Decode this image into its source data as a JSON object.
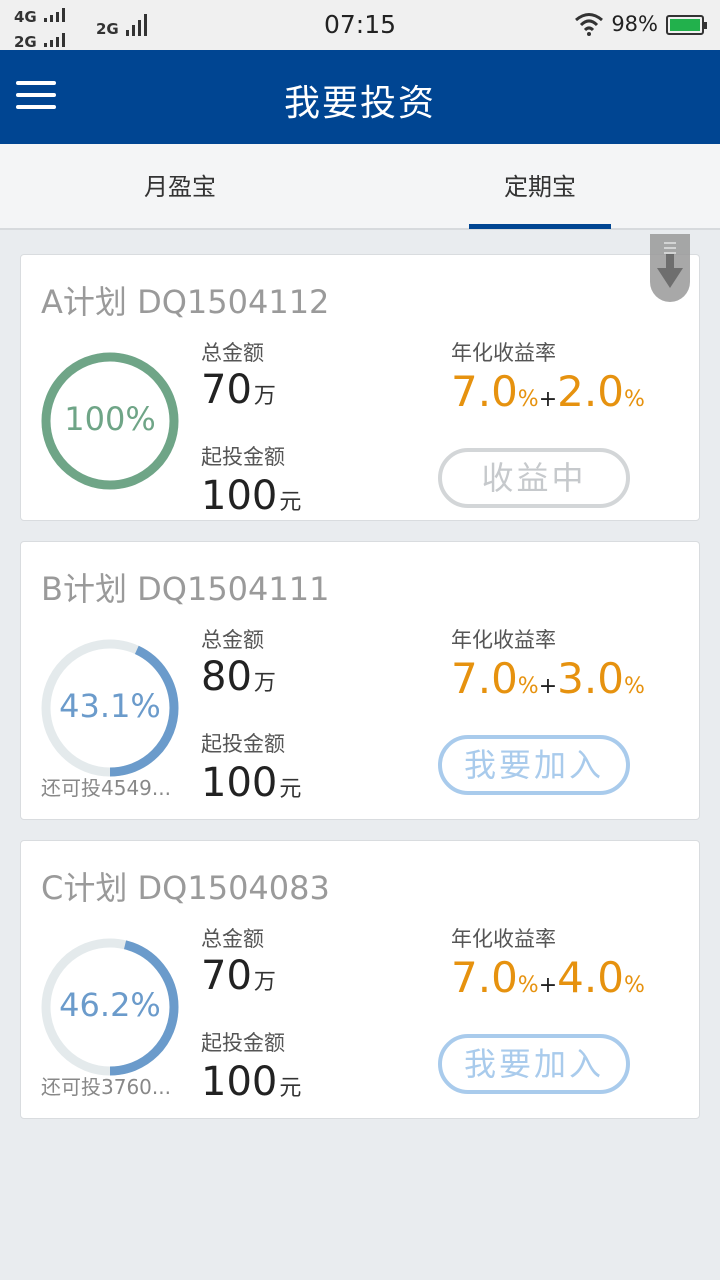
{
  "status_bar": {
    "net1": "4G",
    "net2": "2G",
    "net3": "2G",
    "time": "07:15",
    "battery": "98%"
  },
  "header": {
    "title": "我要投资"
  },
  "tabs": [
    {
      "label": "月盈宝",
      "selected": false
    },
    {
      "label": "定期宝",
      "selected": true
    }
  ],
  "colors": {
    "brand": "#004592",
    "rate": "#e6920f",
    "ring_full": "#6fa587",
    "ring_partial": "#6b9bcb",
    "ring_track": "#e4eaec"
  },
  "labels": {
    "total": "总金额",
    "min_invest": "起投金额",
    "annual_rate": "年化收益率"
  },
  "plans": [
    {
      "title": "A计划 DQ1504112",
      "progress_pct": 100,
      "progress_label": "100%",
      "remain": "",
      "total_value": "70",
      "total_unit": "万",
      "min_value": "100",
      "min_unit": "元",
      "base_rate": "7.0",
      "bonus_rate": "2.0",
      "pct_sign": "%",
      "plus": "+",
      "button": "收益中",
      "button_state": "disabled"
    },
    {
      "title": "B计划 DQ1504111",
      "progress_pct": 43.1,
      "progress_label": "43.1%",
      "remain": "还可投4549...",
      "total_value": "80",
      "total_unit": "万",
      "min_value": "100",
      "min_unit": "元",
      "base_rate": "7.0",
      "bonus_rate": "3.0",
      "pct_sign": "%",
      "plus": "+",
      "button": "我要加入",
      "button_state": "active"
    },
    {
      "title": "C计划 DQ1504083",
      "progress_pct": 46.2,
      "progress_label": "46.2%",
      "remain": "还可投3760...",
      "total_value": "70",
      "total_unit": "万",
      "min_value": "100",
      "min_unit": "元",
      "base_rate": "7.0",
      "bonus_rate": "4.0",
      "pct_sign": "%",
      "plus": "+",
      "button": "我要加入",
      "button_state": "active"
    }
  ]
}
